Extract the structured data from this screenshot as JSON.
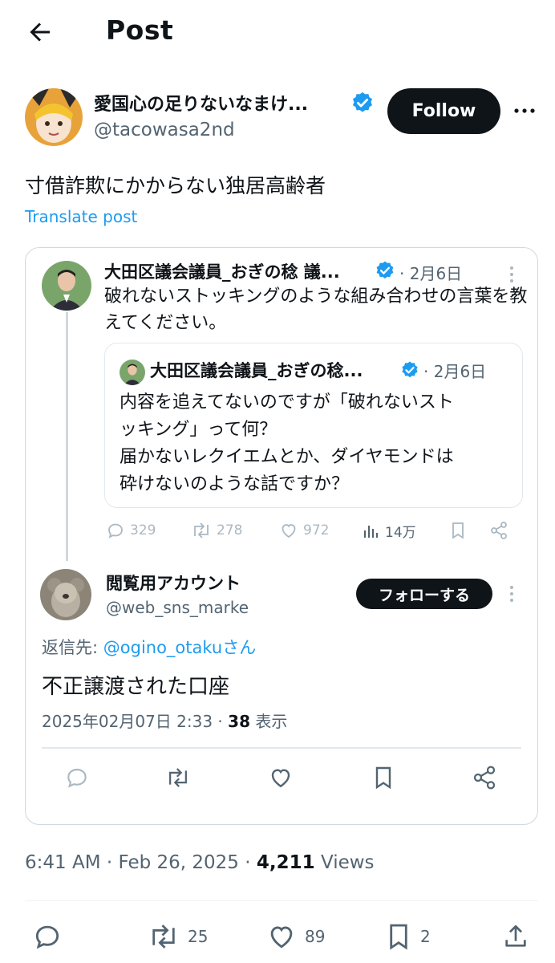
{
  "header": {
    "title": "Post"
  },
  "author": {
    "name": "愛国心の足りないなまけ...",
    "handle": "@tacowasa2nd",
    "follow_label": "Follow"
  },
  "post": {
    "text": "寸借詐欺にかからない独居高齢者",
    "translate_label": "Translate post",
    "time": "6:41 AM",
    "date": "Feb 26, 2025",
    "views_count": "4,211",
    "views_label": "Views",
    "actions": {
      "retweets": "25",
      "likes": "89",
      "bookmarks": "2"
    }
  },
  "embedded": {
    "quoted": {
      "name": "大田区議会議員_おぎの稔 議...",
      "date": "2月6日",
      "text": "破れないストッキングのような組み合わせの言葉を教えてください。",
      "nested": {
        "name": "大田区議会議員_おぎの稔...",
        "date": "2月6日",
        "text_lines": [
          "内容を追えてないのですが「破れないスト",
          "ッキング」って何？",
          "届かないレクイエムとか、ダイヤモンドは",
          "砕けないのような話ですか？"
        ]
      },
      "stats": {
        "replies": "329",
        "retweets": "278",
        "likes": "972",
        "views": "14万"
      }
    },
    "reply": {
      "name": "閲覧用アカウント",
      "handle": "@web_sns_marke",
      "follow_label": "フォローする",
      "reply_to_prefix": "返信先: ",
      "reply_to_handle": "@ogino_otakuさん",
      "text": "不正譲渡された口座",
      "timestamp": "2025年02月07日 2:33",
      "views_count": "38",
      "views_label": "表示"
    }
  },
  "colors": {
    "accent": "#1d9bf0",
    "text": "#0f1419",
    "secondary": "#536471",
    "border": "#cfd9de"
  }
}
